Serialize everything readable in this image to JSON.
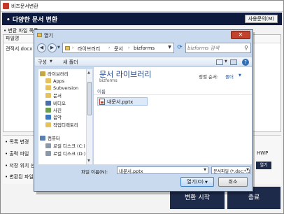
{
  "app": {
    "title": "비즈문서변환",
    "header_title": "• 다양한 문서 변환",
    "manual_button": "사용문의(M)",
    "section_files": "• 변환 파일 목록",
    "file_column": "파일명",
    "file_row": "견적서.docx",
    "options": {
      "section": "• 목록 변경",
      "output_label": "• 출력 파일 ",
      "save_label": "• 저장 위치 선",
      "converter_label": "• 변환된 파일",
      "hwp_label": "HWP",
      "open_label": "열기"
    },
    "convert_button": "변환 시작",
    "exit_button": "종료",
    "brand_color": "#0d1a3d"
  },
  "dialog": {
    "title": "열기",
    "close_glyph": "✕",
    "breadcrumb": [
      "라이브러리",
      "문서",
      "bizforms"
    ],
    "search_placeholder": "bizforms 검색",
    "toolbar": {
      "organize": "구성",
      "new_folder": "새 폴더"
    },
    "nav_items": [
      {
        "label": "라이브러리",
        "icon": "library-icon",
        "color": "#c6a64a",
        "indent": 0
      },
      {
        "label": "Apps",
        "icon": "folder-icon",
        "color": "#e7c25a",
        "indent": 1
      },
      {
        "label": "Subversion",
        "icon": "folder-icon",
        "color": "#e7c25a",
        "indent": 1
      },
      {
        "label": "문서",
        "icon": "documents-icon",
        "color": "#e7c25a",
        "indent": 1
      },
      {
        "label": "비디오",
        "icon": "video-icon",
        "color": "#4a6fa8",
        "indent": 1
      },
      {
        "label": "사진",
        "icon": "picture-icon",
        "color": "#6aa14a",
        "indent": 1
      },
      {
        "label": "음악",
        "icon": "music-icon",
        "color": "#3a78c2",
        "indent": 1
      },
      {
        "label": "작업디렉토리",
        "icon": "folder-icon",
        "color": "#e7c25a",
        "indent": 1
      },
      {
        "label": "컴퓨터",
        "icon": "computer-icon",
        "color": "#5b7fb0",
        "indent": 0
      },
      {
        "label": "로컬 디스크 (C:)",
        "icon": "disk-icon",
        "color": "#8a98aa",
        "indent": 1
      },
      {
        "label": "로컬 디스크 (D:)",
        "icon": "disk-icon",
        "color": "#8a98aa",
        "indent": 1
      }
    ],
    "library_title": "문서 라이브러리",
    "library_subtitle": "bizforms",
    "sort_label": "정렬 순서:",
    "sort_value": "폴더",
    "column_name": "이름",
    "file_item": "내문서.pptx",
    "filename_label": "파일 이름(N):",
    "filename_value": "내문서.pptx",
    "filetype_value": "문서파일 (*.doc;*.docx;*.xls;*.x",
    "open_button": "열기(O)",
    "cancel_button": "취소"
  }
}
